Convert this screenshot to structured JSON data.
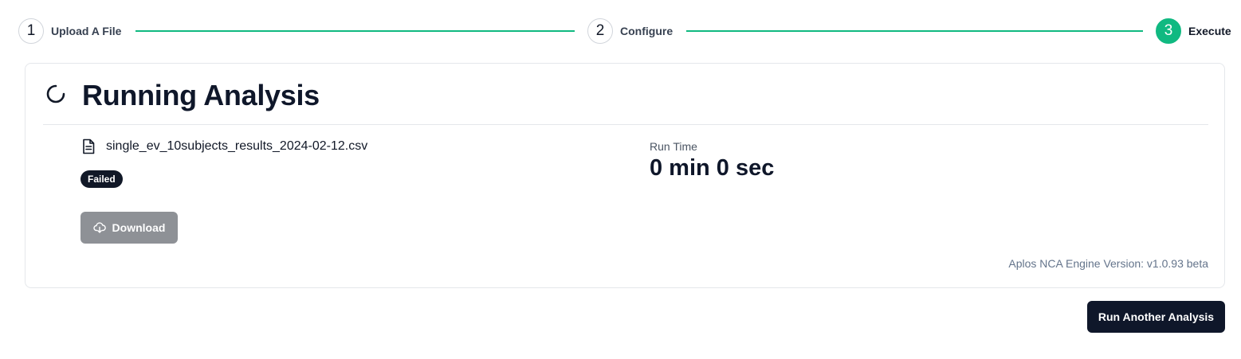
{
  "stepper": {
    "steps": [
      {
        "number": "1",
        "label": "Upload A File",
        "state": "complete"
      },
      {
        "number": "2",
        "label": "Configure",
        "state": "complete"
      },
      {
        "number": "3",
        "label": "Execute",
        "state": "active"
      }
    ],
    "accent_color": "#10b981"
  },
  "analysis": {
    "title": "Running Analysis",
    "status_icon": "spinner-icon",
    "file_icon": "document-icon",
    "file_name": "single_ev_10subjects_results_2024-02-12.csv",
    "status_badge": "Failed",
    "download_icon": "cloud-download-icon",
    "download_label": "Download",
    "run_time_label": "Run Time",
    "run_time_value": "0 min 0 sec",
    "engine_version": "Aplos NCA Engine Version: v1.0.93 beta"
  },
  "actions": {
    "run_another_label": "Run Another Analysis"
  }
}
